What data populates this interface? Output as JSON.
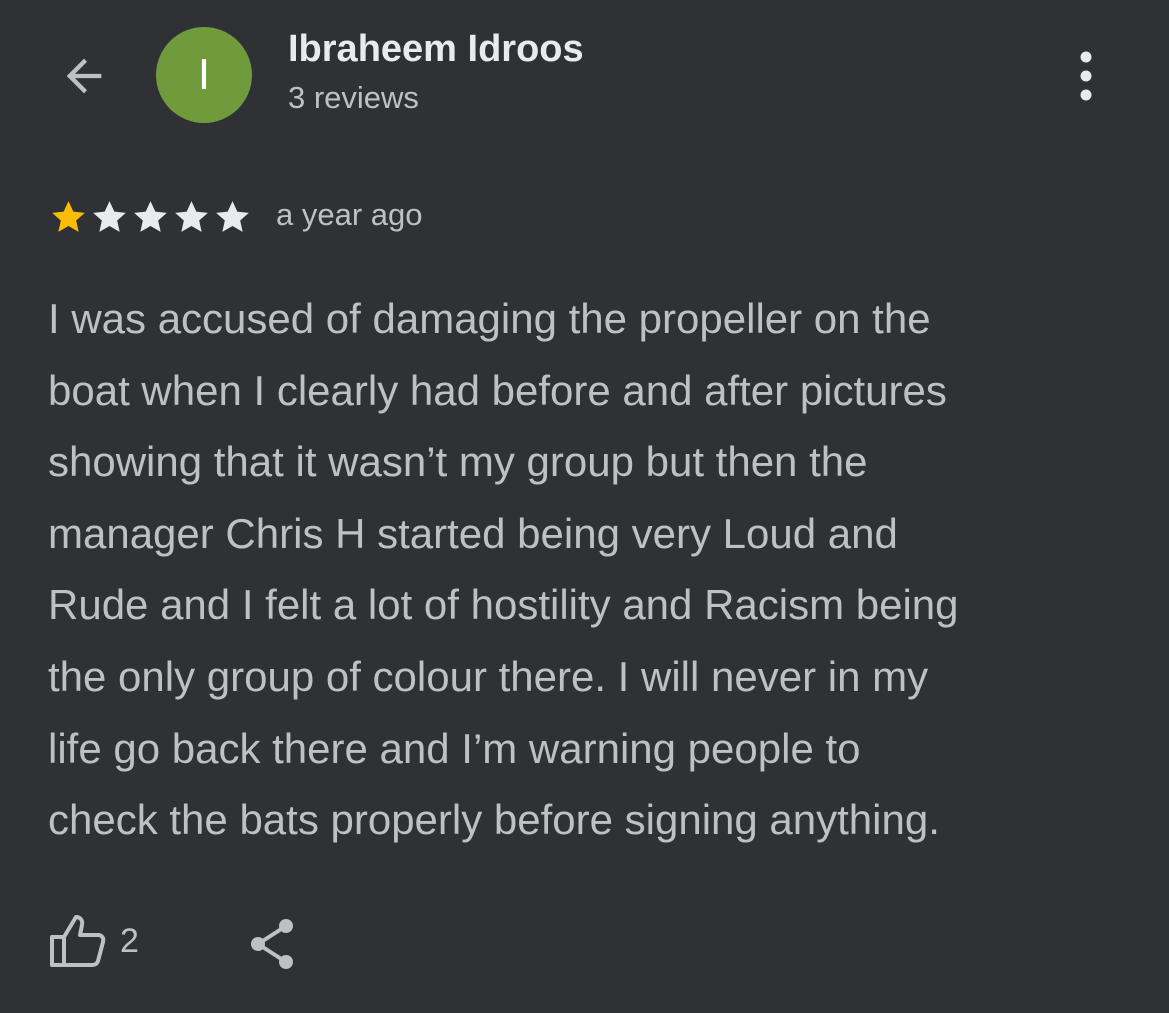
{
  "reviewer": {
    "avatar_initial": "I",
    "avatar_color": "#6f9b3d",
    "name": "Ibraheem Idroos",
    "review_count": "3 reviews"
  },
  "header": {
    "back_icon": "arrow-left-icon",
    "menu_icon": "more-vert-icon"
  },
  "rating": {
    "stars_filled": 1,
    "stars_total": 5,
    "filled_color": "#fbbc04",
    "empty_color": "#e8eaed",
    "time_ago": "a year ago"
  },
  "review": {
    "lines": [
      "I was accused of damaging the propeller on the",
      "boat when I clearly had before and after pictures",
      "showing that it wasn’t my group but then the",
      "manager Chris H started being very Loud and",
      "Rude and I felt a lot of hostility and Racism being",
      "the only group of colour there. I will never in my",
      "life go back there and I’m warning people to",
      "check the bats properly before signing anything."
    ]
  },
  "actions": {
    "like_icon": "thumb-up-icon",
    "like_count": "2",
    "share_icon": "share-icon"
  }
}
